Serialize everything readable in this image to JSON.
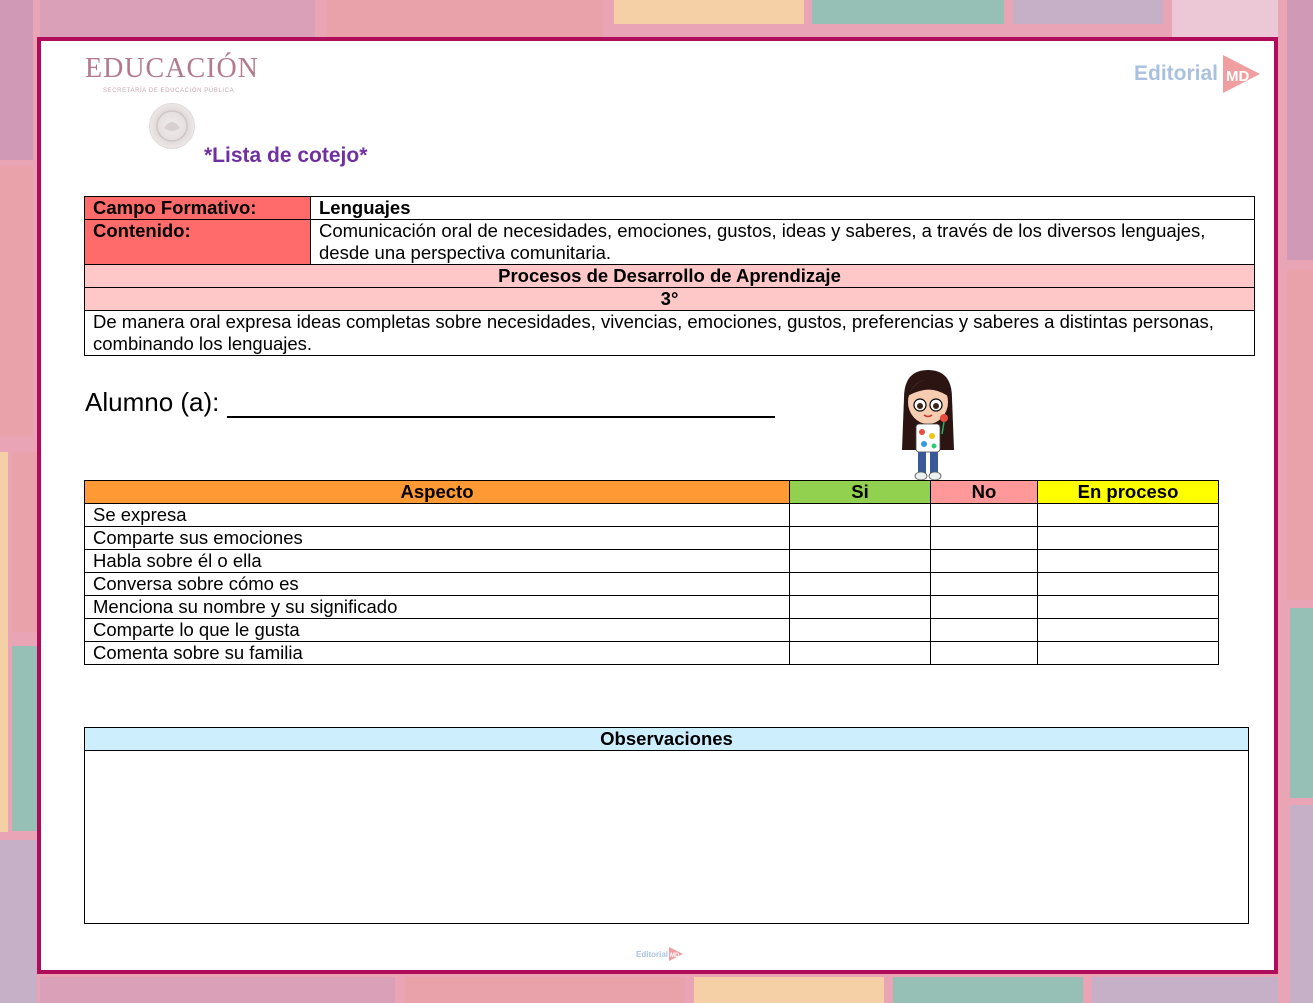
{
  "header": {
    "logo_title": "EDUCACIÓN",
    "logo_subtitle": "SECRETARÍA DE EDUCACIÓN PÚBLICA",
    "brand": "Editorial",
    "brand_mark": "MD"
  },
  "document": {
    "title": "*Lista de cotejo*"
  },
  "info_table": {
    "campo_label": "Campo Formativo:",
    "campo_value": "Lenguajes",
    "contenido_label": "Contenido:",
    "contenido_value": "Comunicación oral de necesidades, emociones, gustos, ideas y saberes, a través de los diversos lenguajes, desde una perspectiva comunitaria.",
    "pda_header": "Procesos de Desarrollo de Aprendizaje",
    "grade": "3°",
    "pda_text": "De manera oral expresa ideas completas sobre necesidades, vivencias, emociones, gustos, preferencias y saberes a distintas personas, combinando los lenguajes."
  },
  "student": {
    "label": "Alumno (a):"
  },
  "checklist": {
    "headers": {
      "aspecto": "Aspecto",
      "si": "Si",
      "no": "No",
      "en_proceso": "En proceso"
    },
    "rows": [
      "Se expresa",
      "Comparte sus emociones",
      "Habla sobre él o ella",
      "Conversa sobre cómo es",
      "Menciona su nombre y su significado",
      "Comparte lo que le gusta",
      "Comenta sobre su familia"
    ]
  },
  "observations": {
    "header": "Observaciones"
  },
  "footer": {
    "brand": "Editorial",
    "brand_mark": "MD"
  },
  "colors": {
    "frame": "#b10b5c",
    "label_red": "#ff6b6b",
    "header_pink": "#ffc8c8",
    "aspect_orange": "#ff9933",
    "yes_green": "#92d050",
    "no_pink": "#ff9999",
    "in_process_yellow": "#ffff00",
    "observations_blue": "#cdeefc",
    "title_purple": "#7030a0"
  }
}
